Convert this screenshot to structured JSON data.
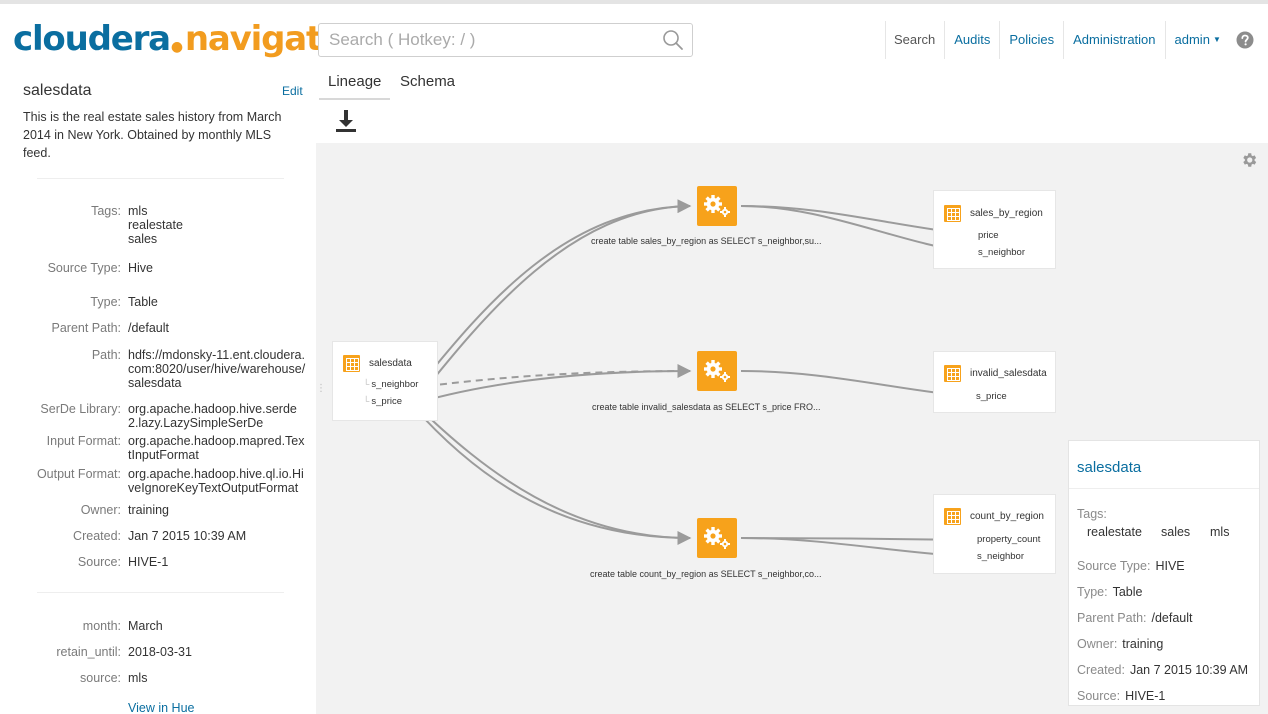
{
  "header": {
    "logo_brand": "cloudera",
    "logo_mark": "●",
    "logo_product": "navigator",
    "search_placeholder": "Search ( Hotkey: / )",
    "nav": {
      "search": "Search",
      "audits": "Audits",
      "policies": "Policies",
      "administration": "Administration",
      "user": "admin"
    }
  },
  "entity": {
    "name": "salesdata",
    "edit_label": "Edit",
    "description": "This is the real estate sales history from March 2014 in New York. Obtained by monthly MLS feed.",
    "tags_label": "Tags:",
    "tags": [
      "mls",
      "realestate",
      "sales"
    ],
    "properties": [
      {
        "label": "Source Type:",
        "value": "Hive"
      },
      {
        "label": "Type:",
        "value": "Table"
      },
      {
        "label": "Parent Path:",
        "value": "/default"
      },
      {
        "label": "Path:",
        "value": "hdfs://mdonsky-11.ent.cloudera.com:8020/user/hive/warehouse/salesdata"
      },
      {
        "label": "SerDe Library:",
        "value": "org.apache.hadoop.hive.serde2.lazy.LazySimpleSerDe"
      },
      {
        "label": "Input Format:",
        "value": "org.apache.hadoop.mapred.TextInputFormat"
      },
      {
        "label": "Output Format:",
        "value": "org.apache.hadoop.hive.ql.io.HiveIgnoreKeyTextOutputFormat"
      },
      {
        "label": "Owner:",
        "value": "training"
      },
      {
        "label": "Created:",
        "value": "Jan 7 2015 10:39 AM"
      },
      {
        "label": "Source:",
        "value": "HIVE-1"
      }
    ],
    "custom_properties": [
      {
        "label": "month:",
        "value": "March"
      },
      {
        "label": "retain_until:",
        "value": "2018-03-31"
      },
      {
        "label": "source:",
        "value": "mls"
      }
    ],
    "view_in_hue": "View in Hue"
  },
  "tabs": [
    {
      "label": "Lineage",
      "active": true
    },
    {
      "label": "Schema",
      "active": false
    }
  ],
  "lineage": {
    "source": {
      "name": "salesdata",
      "columns": [
        "s_neighbor",
        "s_price"
      ]
    },
    "operations": [
      {
        "label": "create table sales_by_region as SELECT s_neighbor,su..."
      },
      {
        "label": "create table invalid_salesdata as SELECT s_price FRO..."
      },
      {
        "label": "create table count_by_region as SELECT s_neighbor,co..."
      }
    ],
    "targets": [
      {
        "name": "sales_by_region",
        "columns": [
          "price",
          "s_neighbor"
        ]
      },
      {
        "name": "invalid_salesdata",
        "columns": [
          "s_price"
        ]
      },
      {
        "name": "count_by_region",
        "columns": [
          "property_count",
          "s_neighbor"
        ]
      }
    ]
  },
  "detail_card": {
    "title": "salesdata",
    "tags_label": "Tags:",
    "tags": [
      "realestate",
      "sales",
      "mls"
    ],
    "rows": [
      {
        "label": "Source Type:",
        "value": "HIVE"
      },
      {
        "label": "Type:",
        "value": "Table"
      },
      {
        "label": "Parent Path:",
        "value": "/default"
      },
      {
        "label": "Owner:",
        "value": "training"
      },
      {
        "label": "Created:",
        "value": "Jan 7 2015 10:39 AM"
      },
      {
        "label": "Source:",
        "value": "HIVE-1"
      }
    ]
  },
  "colors": {
    "brand_blue": "#0a6ea0",
    "brand_orange": "#f29c1f",
    "node_orange": "#f7a21b",
    "edge_gray": "#9b9b9b",
    "canvas_bg": "#f2f2f2"
  },
  "icons": [
    "search-icon",
    "help-icon",
    "download-icon",
    "gear-icon",
    "table-icon",
    "operation-gears-icon"
  ]
}
